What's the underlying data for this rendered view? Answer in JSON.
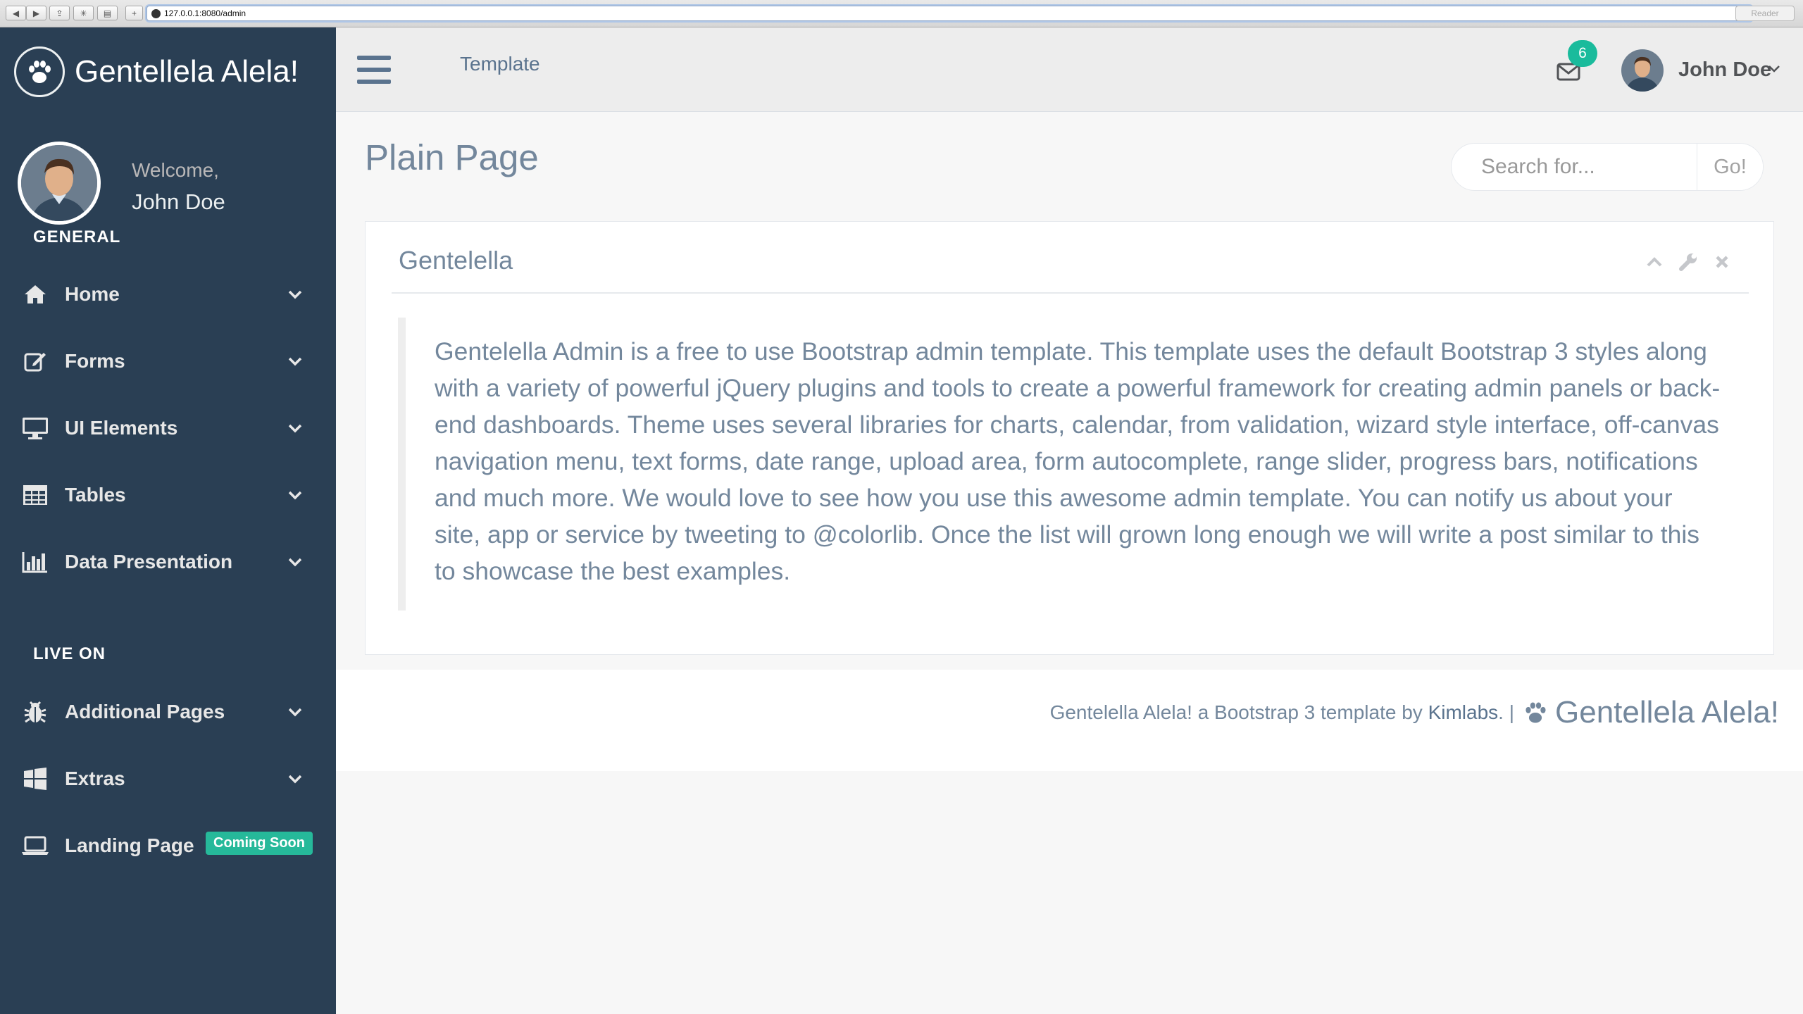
{
  "browser": {
    "url": "127.0.0.1:8080/admin",
    "reader_label": "Reader"
  },
  "sidebar": {
    "brand": "Gentellela Alela!",
    "welcome": "Welcome,",
    "username": "John Doe",
    "section_general": "GENERAL",
    "section_live": "LIVE ON",
    "items": [
      {
        "label": "Home",
        "icon": "home-icon"
      },
      {
        "label": "Forms",
        "icon": "edit-icon"
      },
      {
        "label": "UI Elements",
        "icon": "desktop-icon"
      },
      {
        "label": "Tables",
        "icon": "table-icon"
      },
      {
        "label": "Data Presentation",
        "icon": "bar-chart-icon"
      },
      {
        "label": "Additional Pages",
        "icon": "bug-icon"
      },
      {
        "label": "Extras",
        "icon": "windows-icon"
      },
      {
        "label": "Landing Page",
        "icon": "laptop-icon"
      }
    ],
    "landing_badge": "Coming Soon"
  },
  "topnav": {
    "title": "Template",
    "mail_count": "6",
    "user_name": "John Doe"
  },
  "main": {
    "page_title": "Plain Page",
    "search_placeholder": "Search for...",
    "search_button": "Go!",
    "panel": {
      "title": "Gentelella",
      "body": "Gentelella Admin is a free to use Bootstrap admin template. This template uses the default Bootstrap 3 styles along with a variety of powerful jQuery plugins and tools to create a powerful framework for creating admin panels or back-end dashboards. Theme uses several libraries for charts, calendar, from validation, wizard style interface, off-canvas navigation menu, text forms, date range, upload area, form autocomplete, range slider, progress bars, notifications and much more. We would love to see how you use this awesome admin template. You can notify us about your site, app or service by tweeting to @colorlib. Once the list will grown long enough we will write a post similar to this to showcase the best examples."
    }
  },
  "footer": {
    "text": "Gentelella Alela! a Bootstrap 3 template by",
    "link": "Kimlabs",
    "after_link": ". |",
    "brand": "Gentellela Alela!"
  },
  "colors": {
    "sidebar_bg": "#2A3F54",
    "accent": "#1ABB9C",
    "text": "#73879C"
  }
}
